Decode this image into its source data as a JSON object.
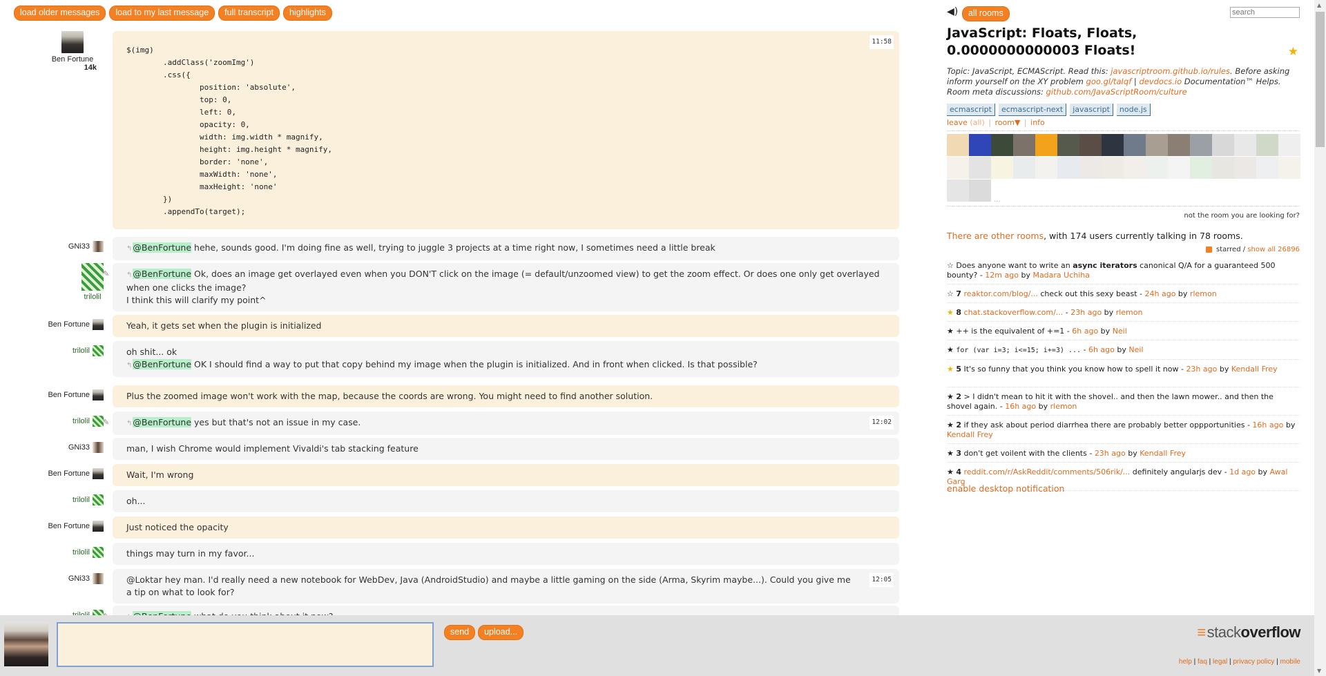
{
  "top_buttons": [
    "load older messages",
    "load to my last message",
    "full transcript",
    "highlights"
  ],
  "first_message": {
    "user": "Ben Fortune",
    "rep": "14k",
    "time": "11:58",
    "code": "$(img)\n        .addClass('zoomImg')\n        .css({\n                position: 'absolute',\n                top: 0,\n                left: 0,\n                opacity: 0,\n                width: img.width * magnify,\n                height: img.height * magnify,\n                border: 'none',\n                maxWidth: 'none',\n                maxHeight: 'none'\n        })\n        .appendTo(target);"
  },
  "messages": [
    {
      "user": "GNi33",
      "mention": "@BenFortune",
      "text": " hehe, sounds good. I'm doing fine as well, trying to juggle 3 projects at a time right now, I sometimes need a little break"
    },
    {
      "user": "trilolil",
      "mention": "@BenFortune",
      "text": " Ok, does an image get overlayed even when you DON'T click on the image (= default/unzoomed view) to get the zoom effect. Or does one only get overlayed when one clicks the image?",
      "text2": "I think this will clarify my point^"
    },
    {
      "user": "Ben Fortune",
      "text": "Yeah, it gets set when the plugin is initialized"
    },
    {
      "user": "trilolil",
      "text": "oh shit... ok",
      "mention2": "@BenFortune",
      "text2": " OK I should find a way to put that copy behind my image when the plugin is initialized. And in front when clicked. Is that possible?"
    },
    {
      "user": "Ben Fortune",
      "text": "Plus the zoomed image won't work with the map, because the coords are wrong. You might need to find another solution."
    },
    {
      "user": "trilolil",
      "mention": "@BenFortune",
      "text": " yes but that's not an issue in my case.",
      "time": "12:02"
    },
    {
      "user": "GNi33",
      "text": "man, I wish Chrome would implement Vivaldi's tab stacking feature"
    },
    {
      "user": "Ben Fortune",
      "text": "Wait, I'm wrong"
    },
    {
      "user": "trilolil",
      "text": "oh..."
    },
    {
      "user": "Ben Fortune",
      "text": "Just noticed the opacity"
    },
    {
      "user": "trilolil",
      "text": "things may turn in my favor..."
    },
    {
      "user": "GNi33",
      "text": "@Loktar hey man. I'd really need a new notebook for WebDev, Java (AndroidStudio) and maybe a little gaming on the side (Arma, Skyrim maybe...). Could you give me a tip on what to look for?",
      "time": "12:05"
    },
    {
      "user": "trilolil",
      "mention": "@BenFortune",
      "text": " what do you think about it now?"
    }
  ],
  "sidebar": {
    "all_rooms": "all rooms",
    "search_placeholder": "search",
    "room_title": "JavaScript: Floats, Floats, 0.0000000000003 Floats!",
    "topic_prefix": "Topic: JavaScript, ECMAScript. Read this: ",
    "topic_link1": "javascriptroom.github.io/rules",
    "topic_mid": ". Before asking inform yourself on the XY problem ",
    "topic_link2": "goo.gl/taIqf",
    "topic_sep": " | ",
    "topic_link3": "devdocs.io",
    "topic_mid2": " Documentation™ Helps. Room meta discussions: ",
    "topic_link4": "github.com/JavaScriptRoom/culture",
    "tags": [
      "ecmascript",
      "ecmascript-next",
      "javascript",
      "node.js"
    ],
    "leave": "leave",
    "all": "(all)",
    "room": "room▼",
    "info": "info",
    "more_users": "...",
    "not_room": "not the room you are looking for?",
    "other_rooms_link": "There are other rooms",
    "other_rooms_text": ", with 174 users currently talking in 78 rooms.",
    "starred_label": "starred",
    "show_all": "show all 26896",
    "enable_notif": "enable desktop notification",
    "starred": [
      {
        "star": "☆",
        "gold": false,
        "count": "",
        "pre": "Does anyone want to write an ",
        "bold": "async iterators",
        "post": " canonical Q/A for a guaranteed 500 bounty? - ",
        "ago": "12m ago",
        "by": "Madara Uchiha"
      },
      {
        "star": "☆",
        "gold": false,
        "count": "7",
        "link": "reaktor.com/blog/...",
        "post": " check out this sexy beast - ",
        "ago": "24h ago",
        "by": "rlemon"
      },
      {
        "star": "★",
        "gold": true,
        "count": "8",
        "link": "chat.stackoverflow.com/...",
        "post": " - ",
        "ago": "23h ago",
        "by": "rlemon"
      },
      {
        "star": "★",
        "gold": false,
        "count": "",
        "pre": "++ is the equivalent of +=1 - ",
        "ago": "6h ago",
        "by": "Neil"
      },
      {
        "star": "★",
        "gold": false,
        "count": "",
        "code": "for (var i=3; i<=15; i+=3) ...",
        "post": " - ",
        "ago": "6h ago",
        "by": "Neil"
      },
      {
        "star": "★",
        "gold": true,
        "count": "5",
        "pre": "It's so funny that you think you know how to spell it now - ",
        "ago": "23h ago",
        "by": "Kendall Frey"
      },
      {
        "star": "★",
        "gold": false,
        "count": "2",
        "pre": "> I didn't mean to hit it with the shovel.. and then the lawn mower.. and then the shovel again. - ",
        "ago": "16h ago",
        "by": "rlemon"
      },
      {
        "star": "★",
        "gold": false,
        "count": "2",
        "pre": "if they ask about period diarrhea there are probably better oppportunities - ",
        "ago": "16h ago",
        "by": "Kendall Frey"
      },
      {
        "star": "★",
        "gold": false,
        "count": "3",
        "pre": "don't get voilent with the clients - ",
        "ago": "23h ago",
        "by": "Kendall Frey"
      },
      {
        "star": "★",
        "gold": false,
        "count": "4",
        "link": "reddit.com/r/AskReddit/comments/506rik/...",
        "post": " definitely angularjs dev - ",
        "ago": "1d ago",
        "by": "Awal Garg"
      }
    ]
  },
  "input": {
    "value": "",
    "send": "send",
    "upload": "upload..."
  },
  "footer": {
    "logo_stack": "stack",
    "logo_overflow": "overflow",
    "links": [
      "help",
      "faq",
      "legal",
      "privacy policy",
      "mobile"
    ]
  },
  "colors": {
    "accent": "#f48024",
    "mine_bubble": "#fbf0dc",
    "other_bubble": "#f4f4f4",
    "mention": "#b6efc9",
    "link": "#e06b1f"
  }
}
